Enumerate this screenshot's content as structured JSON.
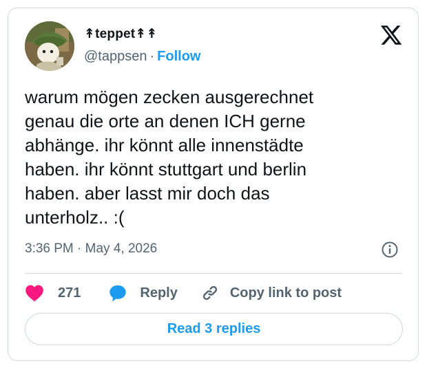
{
  "author": {
    "display_name": "↟teppet↟↟",
    "handle": "@tappsen",
    "separator": "·",
    "follow_label": "Follow"
  },
  "tweet": {
    "text": "warum mögen zecken ausgerechnet\ngenau die orte an denen ICH gerne\nabhänge. ihr könnt alle innenstädte\nhaben. ihr könnt stuttgart und berlin\nhaben. aber lasst mir doch das\nunterholz.. :(",
    "time": "3:36 PM",
    "separator": "·",
    "date": "May 4, 2026"
  },
  "actions": {
    "like_count": "271",
    "reply_label": "Reply",
    "copy_link_label": "Copy link to post"
  },
  "read_replies_label": "Read 3 replies",
  "icons": {
    "brand": "x-logo-icon",
    "info": "info-icon",
    "like": "heart-icon",
    "reply": "speech-bubble-icon",
    "copy": "link-icon"
  },
  "colors": {
    "accent": "#1d9bf0",
    "like": "#f91880",
    "secondary_text": "#536471",
    "border": "#cfd9de"
  }
}
